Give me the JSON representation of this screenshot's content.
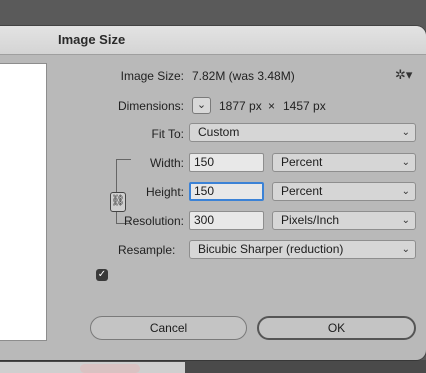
{
  "dialog": {
    "title": "Image Size"
  },
  "image_size": {
    "label": "Image Size:",
    "value": "7.82M (was 3.48M)"
  },
  "dimensions": {
    "label": "Dimensions:",
    "width": "1877 px",
    "times": "×",
    "height": "1457 px"
  },
  "fit_to": {
    "label": "Fit To:",
    "value": "Custom"
  },
  "width_row": {
    "label": "Width:",
    "value": "150",
    "unit": "Percent"
  },
  "height_row": {
    "label": "Height:",
    "value": "150",
    "unit": "Percent"
  },
  "resolution": {
    "label": "Resolution:",
    "value": "300",
    "unit": "Pixels/Inch"
  },
  "resample": {
    "label": "Resample:",
    "value": "Bicubic Sharper (reduction)",
    "checked": true
  },
  "buttons": {
    "cancel": "Cancel",
    "ok": "OK"
  },
  "icons": {
    "gear": "gear-icon",
    "chevron": "chevron-down-icon",
    "link": "link-icon",
    "check": "checkmark-icon"
  }
}
